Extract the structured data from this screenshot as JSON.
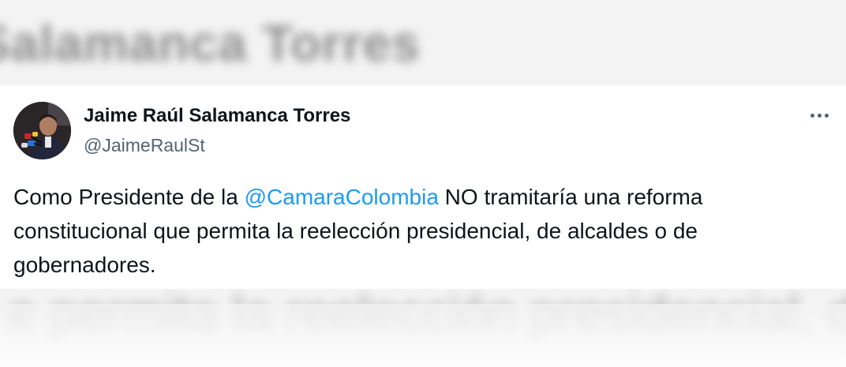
{
  "background": {
    "blurred_top_text": "Salamanca Torres",
    "blurred_bottom_text": "e permita la reelección presidencial, d"
  },
  "tweet": {
    "author_name": "Jaime Raúl Salamanca Torres",
    "author_handle": "@JaimeRaulSt",
    "avatar_icon": "profile-photo",
    "more_icon": "more-options-icon",
    "text_before_mention": "Como Presidente de la ",
    "mention": "@CamaraColombia",
    "text_after_mention": " NO tramitaría una reforma constitucional que permita la reelección presidencial, de alcaldes o de gobernadores."
  },
  "colors": {
    "mention": "#1d9bf0",
    "text": "#0f1419",
    "secondary": "#536471",
    "card_background": "#ffffff"
  }
}
